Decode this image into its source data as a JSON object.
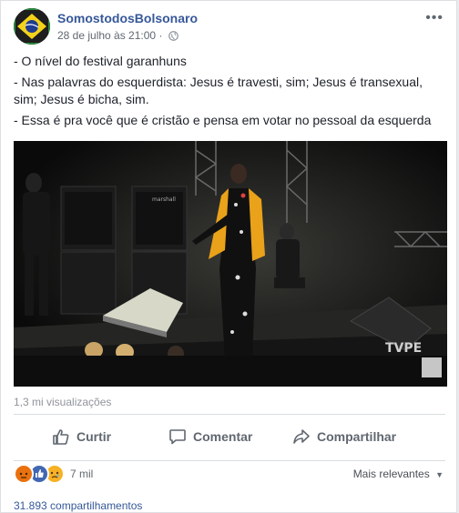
{
  "post": {
    "page_name": "SomostodosBolsonaro",
    "timestamp": "28 de julho às 21:00",
    "privacy_icon": "globe-icon",
    "lines": [
      "- O nível do festival garanhuns",
      "- Nas palavras do esquerdista: Jesus é travesti, sim; Jesus é transexual, sim; Jesus é bicha, sim.",
      "- Essa é pra você que é cristão e pensa em votar no pessoal da esquerda"
    ]
  },
  "video": {
    "watermark": "TVPE",
    "speaker_brand": "marshall"
  },
  "stats": {
    "views": "1,3 mi visualizações",
    "reaction_count": "7 mil",
    "shares": "31.893 compartilhamentos"
  },
  "actions": {
    "like": "Curtir",
    "comment": "Comentar",
    "share": "Compartilhar"
  },
  "filter": {
    "label": "Mais relevantes"
  },
  "colors": {
    "link": "#365899",
    "muted": "#606770",
    "like_blue": "#4267b2",
    "angry": "#e9710f",
    "sad": "#f7b125"
  }
}
